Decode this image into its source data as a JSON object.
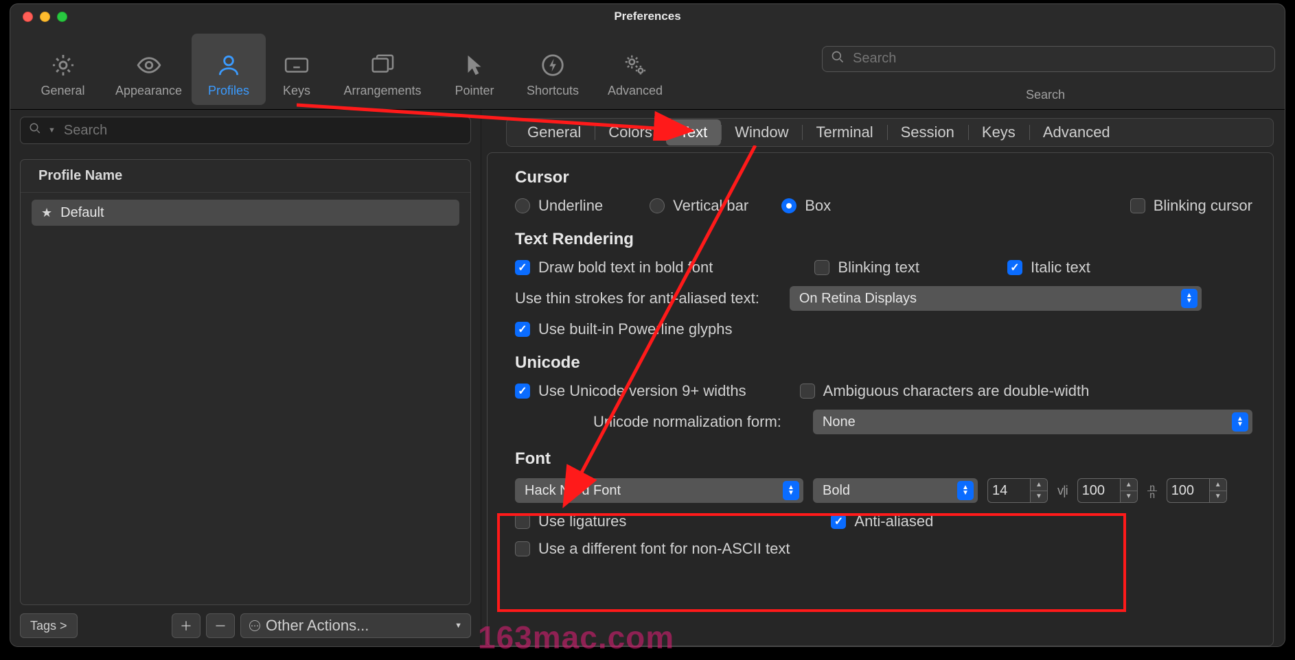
{
  "window": {
    "title": "Preferences"
  },
  "toolbar": {
    "items": [
      {
        "label": "General"
      },
      {
        "label": "Appearance"
      },
      {
        "label": "Profiles"
      },
      {
        "label": "Keys"
      },
      {
        "label": "Arrangements"
      },
      {
        "label": "Pointer"
      },
      {
        "label": "Shortcuts"
      },
      {
        "label": "Advanced"
      }
    ],
    "search_placeholder": "Search",
    "search_label": "Search"
  },
  "sidebar": {
    "search_placeholder": "Search",
    "profile_header": "Profile Name",
    "profiles": [
      {
        "name": "Default"
      }
    ],
    "tags_label": "Tags >",
    "other_actions_label": "Other Actions..."
  },
  "tabs": {
    "items": [
      "General",
      "Colors",
      "Text",
      "Window",
      "Terminal",
      "Session",
      "Keys",
      "Advanced"
    ],
    "active": "Text"
  },
  "cursor": {
    "title": "Cursor",
    "underline": "Underline",
    "vertical_bar": "Vertical bar",
    "box": "Box",
    "blinking": "Blinking cursor"
  },
  "text_rendering": {
    "title": "Text Rendering",
    "draw_bold": "Draw bold text in bold font",
    "blinking_text": "Blinking text",
    "italic_text": "Italic text",
    "thin_strokes_label": "Use thin strokes for anti-aliased text:",
    "thin_strokes_value": "On Retina Displays",
    "powerline": "Use built-in Powerline glyphs"
  },
  "unicode": {
    "title": "Unicode",
    "v9_widths": "Use Unicode version 9+ widths",
    "ambiguous": "Ambiguous characters are double-width",
    "norm_label": "Unicode normalization form:",
    "norm_value": "None"
  },
  "font": {
    "title": "Font",
    "family": "Hack Nerd Font",
    "weight": "Bold",
    "size": "14",
    "letter_spacing": "100",
    "line_height": "100",
    "use_ligatures": "Use ligatures",
    "anti_aliased": "Anti-aliased",
    "diff_font": "Use a different font for non-ASCII text"
  },
  "watermark": "163mac.com"
}
